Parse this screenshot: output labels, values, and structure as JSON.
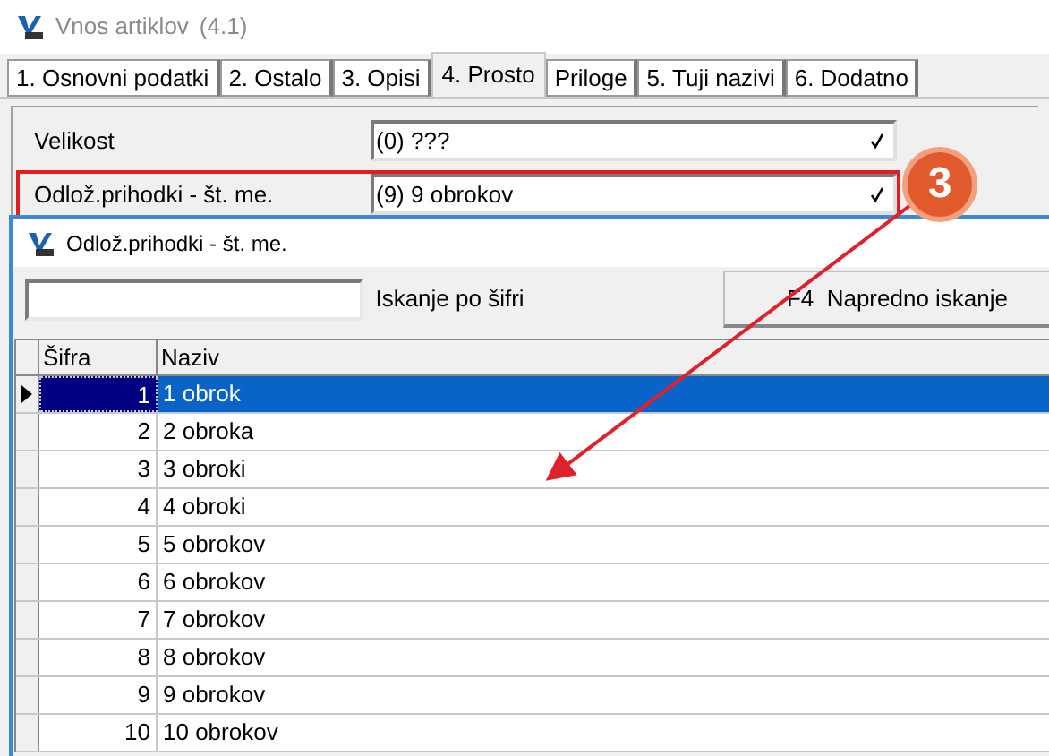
{
  "window": {
    "title": "Vnos artiklov",
    "version": "(4.1)"
  },
  "tabs": [
    {
      "label": "1. Osnovni podatki",
      "selected": false
    },
    {
      "label": "2. Ostalo",
      "selected": false
    },
    {
      "label": "3. Opisi",
      "selected": false
    },
    {
      "label": "4. Prosto",
      "selected": true
    },
    {
      "label": "Priloge",
      "selected": false
    },
    {
      "label": "5. Tuji nazivi",
      "selected": false
    },
    {
      "label": "6. Dodatno",
      "selected": false
    }
  ],
  "fields": [
    {
      "label": "Velikost",
      "value": "(0) ???",
      "highlighted": false
    },
    {
      "label": "Odlož.prihodki - št. me.",
      "value": "(9) 9 obrokov",
      "highlighted": true
    }
  ],
  "annotation": {
    "number": "3"
  },
  "popup": {
    "title": "Odlož.prihodki - št. me.",
    "search_label": "Iskanje po šifri",
    "advanced_button": "F4  Napredno iskanje",
    "columns": [
      "Šifra",
      "Naziv"
    ],
    "rows": [
      {
        "code": "1",
        "name": "1 obrok",
        "selected": true
      },
      {
        "code": "2",
        "name": "2 obroka",
        "selected": false
      },
      {
        "code": "3",
        "name": "3 obroki",
        "selected": false
      },
      {
        "code": "4",
        "name": "4 obroki",
        "selected": false
      },
      {
        "code": "5",
        "name": "5 obrokov",
        "selected": false
      },
      {
        "code": "6",
        "name": "6 obrokov",
        "selected": false
      },
      {
        "code": "7",
        "name": "7 obrokov",
        "selected": false
      },
      {
        "code": "8",
        "name": "8 obrokov",
        "selected": false
      },
      {
        "code": "9",
        "name": "9 obrokov",
        "selected": false
      },
      {
        "code": "10",
        "name": "10 obrokov",
        "selected": false
      }
    ]
  }
}
